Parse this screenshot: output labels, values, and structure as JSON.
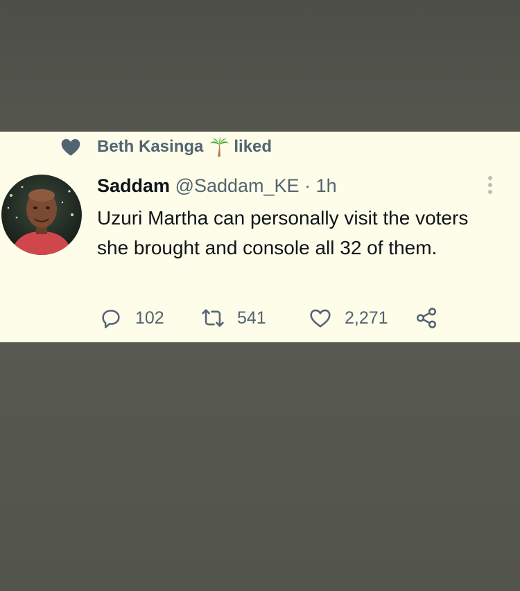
{
  "social_context": {
    "user_name": "Beth Kasinga",
    "emoji_icon": "palm-tree-icon",
    "action": "liked"
  },
  "tweet": {
    "author_name": "Saddam",
    "handle": "@Saddam_KE",
    "separator": "·",
    "time": "1h",
    "text": "Uzuri Martha can personally visit the voters she brought and console all 32 of them."
  },
  "actions": {
    "replies": "102",
    "retweets": "541",
    "likes": "2,271"
  },
  "colors": {
    "card_background": "#fdfde9",
    "page_background": "#54554d",
    "primary_text": "#0f1419",
    "secondary_text": "#536471"
  }
}
